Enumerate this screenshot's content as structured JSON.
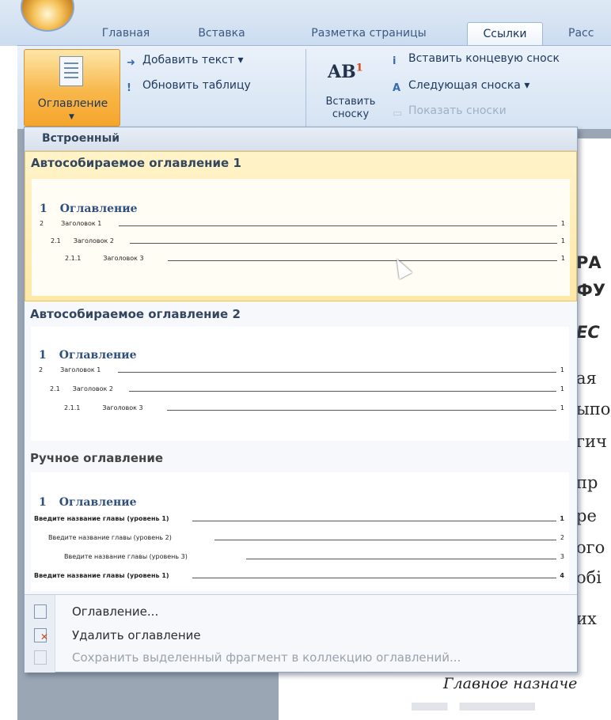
{
  "tabs": [
    {
      "label": "Главная"
    },
    {
      "label": "Вставка"
    },
    {
      "label": "Разметка страницы"
    },
    {
      "label": "Ссылки",
      "active": true
    },
    {
      "label": "Расс"
    }
  ],
  "ribbon": {
    "toc_button": "Оглавление",
    "add_text": "Добавить текст ▾",
    "update_table": "Обновить таблицу",
    "insert_footnote": "Вставить сноску",
    "footnote_icon_text": "AB",
    "footnote_icon_sup": "1",
    "insert_endnote": "Вставить концевую сноск",
    "next_footnote": "Следующая сноска ▾",
    "show_notes": "Показать сноски"
  },
  "gallery": {
    "header": "Встроенный",
    "items": [
      {
        "title": "Автособираемое оглавление 1",
        "heading_num": "1",
        "heading": "Оглавление",
        "rows": [
          {
            "num": "2",
            "text": "Заголовок 1",
            "page": "1"
          },
          {
            "num": "2.1",
            "text": "Заголовок 2",
            "page": "1"
          },
          {
            "num": "2.1.1",
            "text": "Заголовок 3",
            "page": "1"
          }
        ]
      },
      {
        "title": "Автособираемое оглавление 2",
        "heading_num": "1",
        "heading": "Оглавление",
        "rows": [
          {
            "num": "2",
            "text": "Заголовок 1",
            "page": "1"
          },
          {
            "num": "2.1",
            "text": "Заголовок 2",
            "page": "1"
          },
          {
            "num": "2.1.1",
            "text": "Заголовок 3",
            "page": "1"
          }
        ]
      },
      {
        "title": "Ручное оглавление",
        "heading_num": "1",
        "heading": "Оглавление",
        "rows": [
          {
            "text": "Введите название главы (уровень 1)",
            "page": "1"
          },
          {
            "text": "Введите название главы (уровень 2)",
            "page": "2"
          },
          {
            "text": "Введите название главы (уровень 3)",
            "page": "3"
          },
          {
            "text": "Введите название главы (уровень 1)",
            "page": "4"
          }
        ]
      }
    ],
    "menu": {
      "toc_dialog": "Оглавление...",
      "delete_toc": "Удалить оглавление",
      "save_selection": "Сохранить выделенный фрагмент в коллекцию оглавлений..."
    }
  },
  "document": {
    "lines": [
      "РА",
      "ФУ",
      "ЕС",
      "ая",
      "ыпо",
      "гич",
      "пр",
      "ре",
      "ого",
      "обі",
      "их"
    ],
    "main_text": "Главное назначе"
  }
}
